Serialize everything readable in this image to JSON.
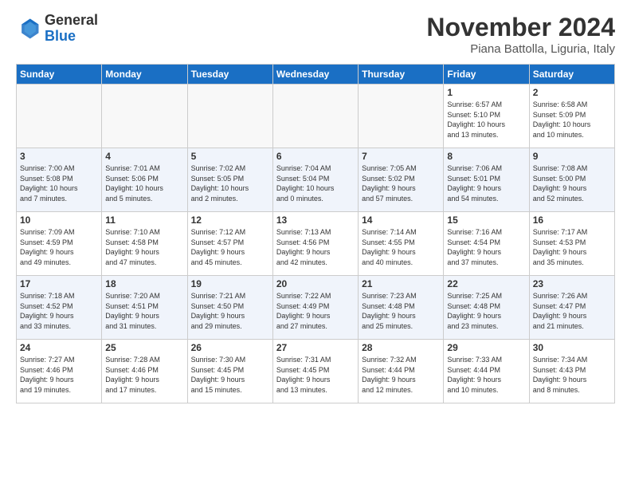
{
  "header": {
    "logo_general": "General",
    "logo_blue": "Blue",
    "month_title": "November 2024",
    "location": "Piana Battolla, Liguria, Italy"
  },
  "days_of_week": [
    "Sunday",
    "Monday",
    "Tuesday",
    "Wednesday",
    "Thursday",
    "Friday",
    "Saturday"
  ],
  "weeks": [
    [
      {
        "day": "",
        "info": ""
      },
      {
        "day": "",
        "info": ""
      },
      {
        "day": "",
        "info": ""
      },
      {
        "day": "",
        "info": ""
      },
      {
        "day": "",
        "info": ""
      },
      {
        "day": "1",
        "info": "Sunrise: 6:57 AM\nSunset: 5:10 PM\nDaylight: 10 hours\nand 13 minutes."
      },
      {
        "day": "2",
        "info": "Sunrise: 6:58 AM\nSunset: 5:09 PM\nDaylight: 10 hours\nand 10 minutes."
      }
    ],
    [
      {
        "day": "3",
        "info": "Sunrise: 7:00 AM\nSunset: 5:08 PM\nDaylight: 10 hours\nand 7 minutes."
      },
      {
        "day": "4",
        "info": "Sunrise: 7:01 AM\nSunset: 5:06 PM\nDaylight: 10 hours\nand 5 minutes."
      },
      {
        "day": "5",
        "info": "Sunrise: 7:02 AM\nSunset: 5:05 PM\nDaylight: 10 hours\nand 2 minutes."
      },
      {
        "day": "6",
        "info": "Sunrise: 7:04 AM\nSunset: 5:04 PM\nDaylight: 10 hours\nand 0 minutes."
      },
      {
        "day": "7",
        "info": "Sunrise: 7:05 AM\nSunset: 5:02 PM\nDaylight: 9 hours\nand 57 minutes."
      },
      {
        "day": "8",
        "info": "Sunrise: 7:06 AM\nSunset: 5:01 PM\nDaylight: 9 hours\nand 54 minutes."
      },
      {
        "day": "9",
        "info": "Sunrise: 7:08 AM\nSunset: 5:00 PM\nDaylight: 9 hours\nand 52 minutes."
      }
    ],
    [
      {
        "day": "10",
        "info": "Sunrise: 7:09 AM\nSunset: 4:59 PM\nDaylight: 9 hours\nand 49 minutes."
      },
      {
        "day": "11",
        "info": "Sunrise: 7:10 AM\nSunset: 4:58 PM\nDaylight: 9 hours\nand 47 minutes."
      },
      {
        "day": "12",
        "info": "Sunrise: 7:12 AM\nSunset: 4:57 PM\nDaylight: 9 hours\nand 45 minutes."
      },
      {
        "day": "13",
        "info": "Sunrise: 7:13 AM\nSunset: 4:56 PM\nDaylight: 9 hours\nand 42 minutes."
      },
      {
        "day": "14",
        "info": "Sunrise: 7:14 AM\nSunset: 4:55 PM\nDaylight: 9 hours\nand 40 minutes."
      },
      {
        "day": "15",
        "info": "Sunrise: 7:16 AM\nSunset: 4:54 PM\nDaylight: 9 hours\nand 37 minutes."
      },
      {
        "day": "16",
        "info": "Sunrise: 7:17 AM\nSunset: 4:53 PM\nDaylight: 9 hours\nand 35 minutes."
      }
    ],
    [
      {
        "day": "17",
        "info": "Sunrise: 7:18 AM\nSunset: 4:52 PM\nDaylight: 9 hours\nand 33 minutes."
      },
      {
        "day": "18",
        "info": "Sunrise: 7:20 AM\nSunset: 4:51 PM\nDaylight: 9 hours\nand 31 minutes."
      },
      {
        "day": "19",
        "info": "Sunrise: 7:21 AM\nSunset: 4:50 PM\nDaylight: 9 hours\nand 29 minutes."
      },
      {
        "day": "20",
        "info": "Sunrise: 7:22 AM\nSunset: 4:49 PM\nDaylight: 9 hours\nand 27 minutes."
      },
      {
        "day": "21",
        "info": "Sunrise: 7:23 AM\nSunset: 4:48 PM\nDaylight: 9 hours\nand 25 minutes."
      },
      {
        "day": "22",
        "info": "Sunrise: 7:25 AM\nSunset: 4:48 PM\nDaylight: 9 hours\nand 23 minutes."
      },
      {
        "day": "23",
        "info": "Sunrise: 7:26 AM\nSunset: 4:47 PM\nDaylight: 9 hours\nand 21 minutes."
      }
    ],
    [
      {
        "day": "24",
        "info": "Sunrise: 7:27 AM\nSunset: 4:46 PM\nDaylight: 9 hours\nand 19 minutes."
      },
      {
        "day": "25",
        "info": "Sunrise: 7:28 AM\nSunset: 4:46 PM\nDaylight: 9 hours\nand 17 minutes."
      },
      {
        "day": "26",
        "info": "Sunrise: 7:30 AM\nSunset: 4:45 PM\nDaylight: 9 hours\nand 15 minutes."
      },
      {
        "day": "27",
        "info": "Sunrise: 7:31 AM\nSunset: 4:45 PM\nDaylight: 9 hours\nand 13 minutes."
      },
      {
        "day": "28",
        "info": "Sunrise: 7:32 AM\nSunset: 4:44 PM\nDaylight: 9 hours\nand 12 minutes."
      },
      {
        "day": "29",
        "info": "Sunrise: 7:33 AM\nSunset: 4:44 PM\nDaylight: 9 hours\nand 10 minutes."
      },
      {
        "day": "30",
        "info": "Sunrise: 7:34 AM\nSunset: 4:43 PM\nDaylight: 9 hours\nand 8 minutes."
      }
    ]
  ]
}
